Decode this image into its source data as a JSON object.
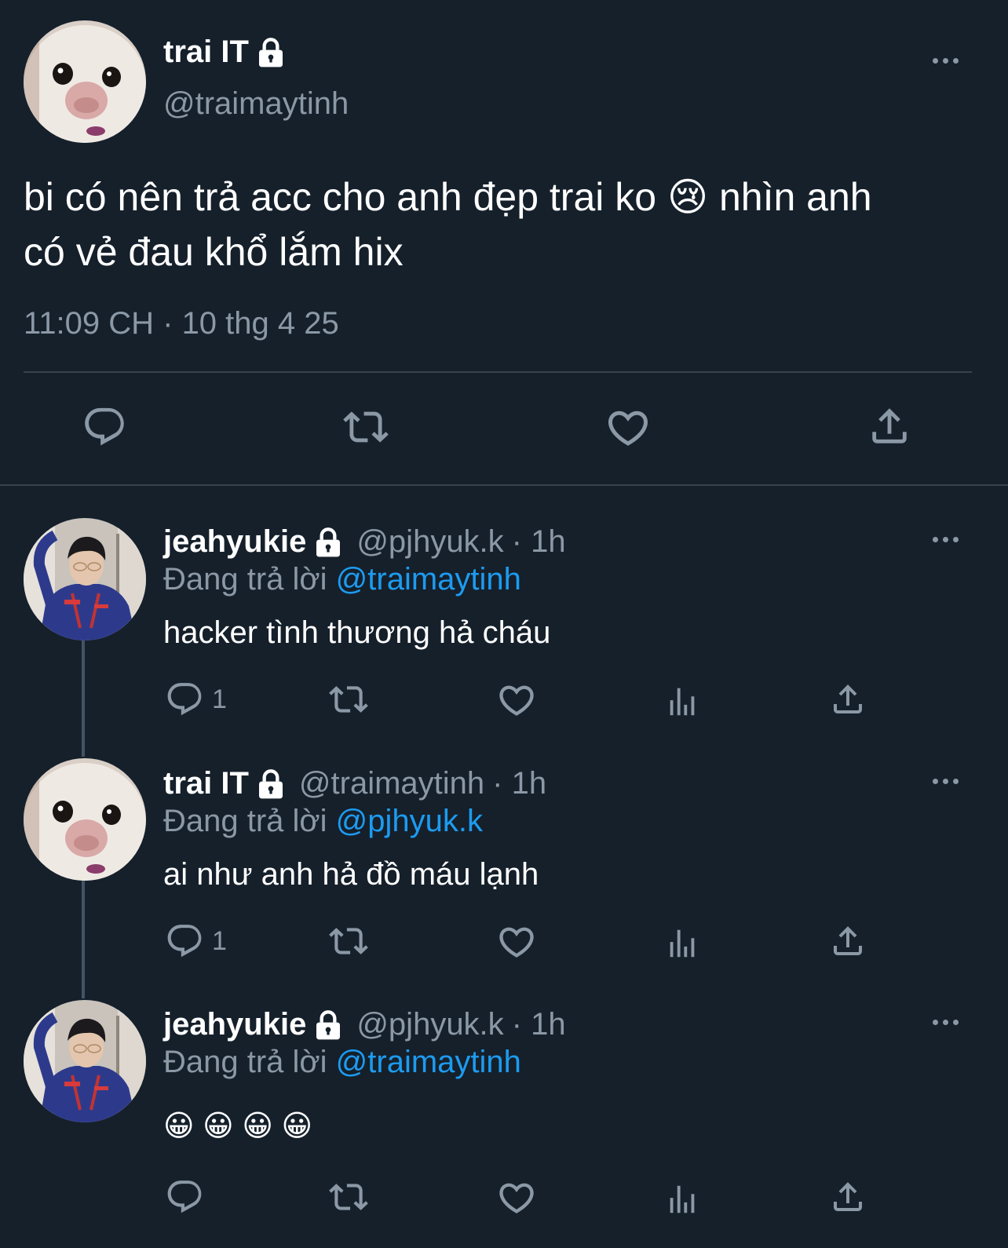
{
  "main_tweet": {
    "name": "trai IT",
    "handle": "@traimaytinh",
    "text_line1": "bi có nên trả acc cho anh đẹp trai ko 😢 nhìn anh",
    "text_line2": "có vẻ đau khổ lắm hix",
    "timestamp": "11:09 CH · 10 thg 4 25"
  },
  "replies": [
    {
      "name": "jeahyukie",
      "handle": "@pjhyuk.k",
      "time": "· 1h",
      "replying_prefix": "Đang trả lời",
      "replying_to": "@traimaytinh",
      "text": "hacker tình thương hả cháu",
      "reply_count": "1"
    },
    {
      "name": "trai IT",
      "handle": "@traimaytinh",
      "time": "· 1h",
      "replying_prefix": "Đang trả lời",
      "replying_to": "@pjhyuk.k",
      "text": "ai như anh hả đồ máu lạnh",
      "reply_count": "1"
    },
    {
      "name": "jeahyukie",
      "handle": "@pjhyuk.k",
      "time": "· 1h",
      "replying_prefix": "Đang trả lời",
      "replying_to": "@traimaytinh",
      "text": "😀 😀 😀 😀",
      "reply_count": ""
    }
  ],
  "icons": {
    "more": "more-horizontal-icon",
    "reply": "reply-icon",
    "retweet": "retweet-icon",
    "like": "like-icon",
    "views": "views-icon",
    "share": "share-icon",
    "lock": "lock-icon"
  },
  "colors": {
    "background": "#15202b",
    "muted": "#8b98a5",
    "link": "#1d9bf0",
    "divider": "#38444d"
  }
}
